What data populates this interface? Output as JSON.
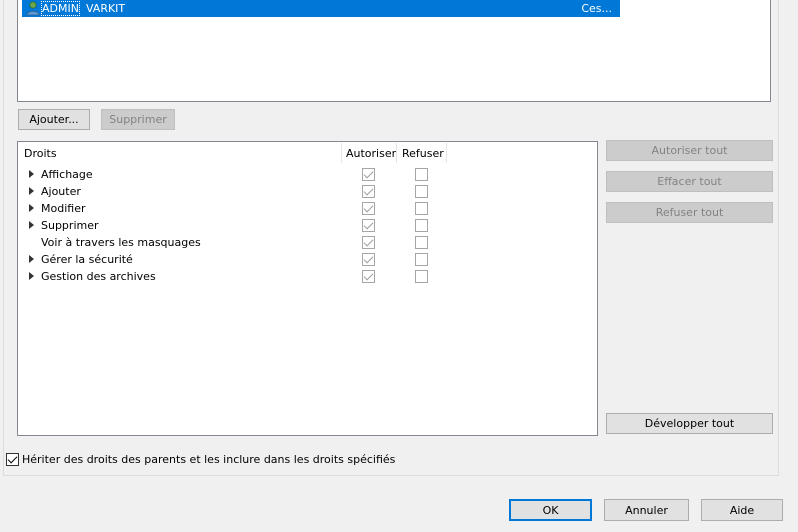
{
  "users": {
    "selected": {
      "name_part1": "ADMIN",
      "name_part2": "VARKIT",
      "description": "Ces..."
    }
  },
  "user_buttons": {
    "add_label": "Ajouter...",
    "remove_label": "Supprimer"
  },
  "rights_table": {
    "columns": {
      "rights": "Droits",
      "allow": "Autoriser",
      "deny": "Refuser"
    },
    "rows": [
      {
        "label": "Affichage",
        "expandable": true,
        "allow": true,
        "deny": false
      },
      {
        "label": "Ajouter",
        "expandable": true,
        "allow": true,
        "deny": false
      },
      {
        "label": "Modifier",
        "expandable": true,
        "allow": true,
        "deny": false
      },
      {
        "label": "Supprimer",
        "expandable": true,
        "allow": true,
        "deny": false
      },
      {
        "label": "Voir à travers les masquages",
        "expandable": false,
        "allow": true,
        "deny": false
      },
      {
        "label": "Gérer la sécurité",
        "expandable": true,
        "allow": true,
        "deny": false
      },
      {
        "label": "Gestion des archives",
        "expandable": true,
        "allow": true,
        "deny": false
      }
    ]
  },
  "side_buttons": {
    "allow_all": "Autoriser tout",
    "clear_all": "Effacer tout",
    "deny_all": "Refuser tout",
    "expand_all": "Développer tout"
  },
  "inherit": {
    "label": "Hériter des droits des parents et les inclure dans les droits spécifiés",
    "checked": true
  },
  "dialog_buttons": {
    "ok": "OK",
    "cancel": "Annuler",
    "help": "Aide"
  },
  "colors": {
    "selection": "#0078d7",
    "disabled_text": "#838383"
  }
}
